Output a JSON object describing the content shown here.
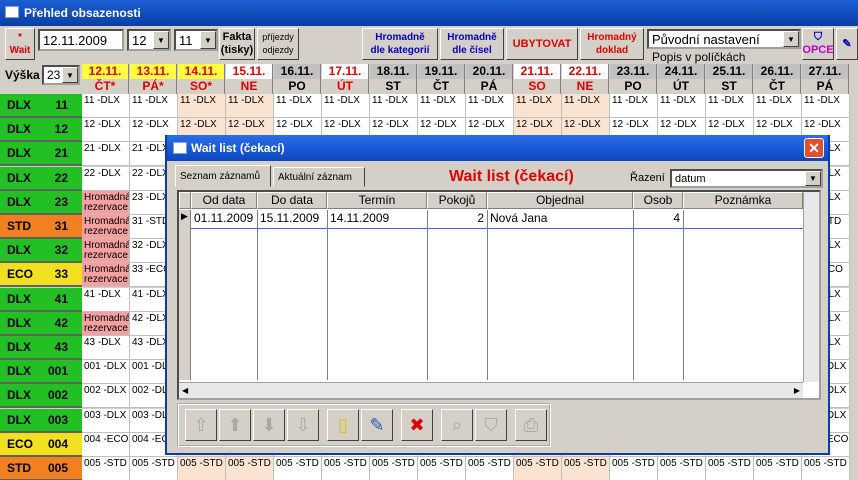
{
  "window": {
    "title": "Přehled obsazenosti"
  },
  "toolbar": {
    "wait_star": "*",
    "wait_label": "Wait",
    "date": "12.11.2009",
    "hour": "12",
    "minute": "11",
    "fakta_1": "Fakta",
    "fakta_2": "(tisky)",
    "prij_1": "příjezdy",
    "prij_2": "odjezdy",
    "hrom_kat_1": "Hromadně",
    "hrom_kat_2": "dle kategorií",
    "hrom_cis_1": "Hromadně",
    "hrom_cis_2": "dle čísel",
    "ubytovat": "UBYTOVAT",
    "hrom_dok_1": "Hromadný",
    "hrom_dok_2": "doklad",
    "settings": "Původní nastavení",
    "popis": "Popis v políčkách",
    "opce": "OPCE"
  },
  "grid_header": {
    "vyska_label": "Výška",
    "vyska_value": "23"
  },
  "days": [
    {
      "date": "12.11.",
      "day": "ČT*"
    },
    {
      "date": "13.11.",
      "day": "PÁ*"
    },
    {
      "date": "14.11.",
      "day": "SO*"
    },
    {
      "date": "15.11.",
      "day": "NE"
    },
    {
      "date": "16.11.",
      "day": "PO"
    },
    {
      "date": "17.11.",
      "day": "ÚT"
    },
    {
      "date": "18.11.",
      "day": "ST"
    },
    {
      "date": "19.11.",
      "day": "ČT"
    },
    {
      "date": "20.11.",
      "day": "PÁ"
    },
    {
      "date": "21.11.",
      "day": "SO"
    },
    {
      "date": "22.11.",
      "day": "NE"
    },
    {
      "date": "23.11.",
      "day": "PO"
    },
    {
      "date": "24.11.",
      "day": "ÚT"
    },
    {
      "date": "25.11.",
      "day": "ST"
    },
    {
      "date": "26.11.",
      "day": "ČT"
    },
    {
      "date": "27.11.",
      "day": "PÁ"
    }
  ],
  "rooms": [
    {
      "cat": "DLX",
      "num": "11",
      "color": "#22c022"
    },
    {
      "cat": "DLX",
      "num": "12",
      "color": "#22c022"
    },
    {
      "cat": "DLX",
      "num": "21",
      "color": "#22c022"
    },
    {
      "cat": "DLX",
      "num": "22",
      "color": "#22c022"
    },
    {
      "cat": "DLX",
      "num": "23",
      "color": "#22c022"
    },
    {
      "cat": "STD",
      "num": "31",
      "color": "#f08020"
    },
    {
      "cat": "DLX",
      "num": "32",
      "color": "#22c022"
    },
    {
      "cat": "ECO",
      "num": "33",
      "color": "#f0e020"
    },
    {
      "cat": "DLX",
      "num": "41",
      "color": "#22c022"
    },
    {
      "cat": "DLX",
      "num": "42",
      "color": "#22c022"
    },
    {
      "cat": "DLX",
      "num": "43",
      "color": "#22c022"
    },
    {
      "cat": "DLX",
      "num": "001",
      "color": "#22c022"
    },
    {
      "cat": "DLX",
      "num": "002",
      "color": "#22c022"
    },
    {
      "cat": "DLX",
      "num": "003",
      "color": "#22c022"
    },
    {
      "cat": "ECO",
      "num": "004",
      "color": "#f0e020"
    },
    {
      "cat": "STD",
      "num": "005",
      "color": "#f08020"
    }
  ],
  "cell_texts": [
    "11 -DLX",
    "12 -DLX",
    "21 -DLX",
    "22 -DLX",
    "23 -DLX",
    "31 -STD",
    "32 -DLX",
    "33 -ECO",
    "41 -DLX",
    "42 -DLX",
    "43 -DLX",
    "001 -DLX",
    "002 -DLX",
    "003 -DLX",
    "004 -ECO",
    "005 -STD"
  ],
  "tentative": "Hromadná rezervace",
  "dialog": {
    "title": "Wait list (čekací)",
    "heading": "Wait list (čekací)",
    "tab1": "Seznam záznamů",
    "tab2": "Aktuální záznam",
    "sort_label": "Řazení",
    "sort_value": "datum",
    "columns": [
      "Od data",
      "Do data",
      "Termín",
      "Pokojů",
      "Objednal",
      "Osob",
      "Poznámka"
    ],
    "rows": [
      [
        "01.11.2009",
        "15.11.2009",
        "14.11.2009",
        "2",
        "Nová Jana",
        "4",
        ""
      ]
    ]
  }
}
